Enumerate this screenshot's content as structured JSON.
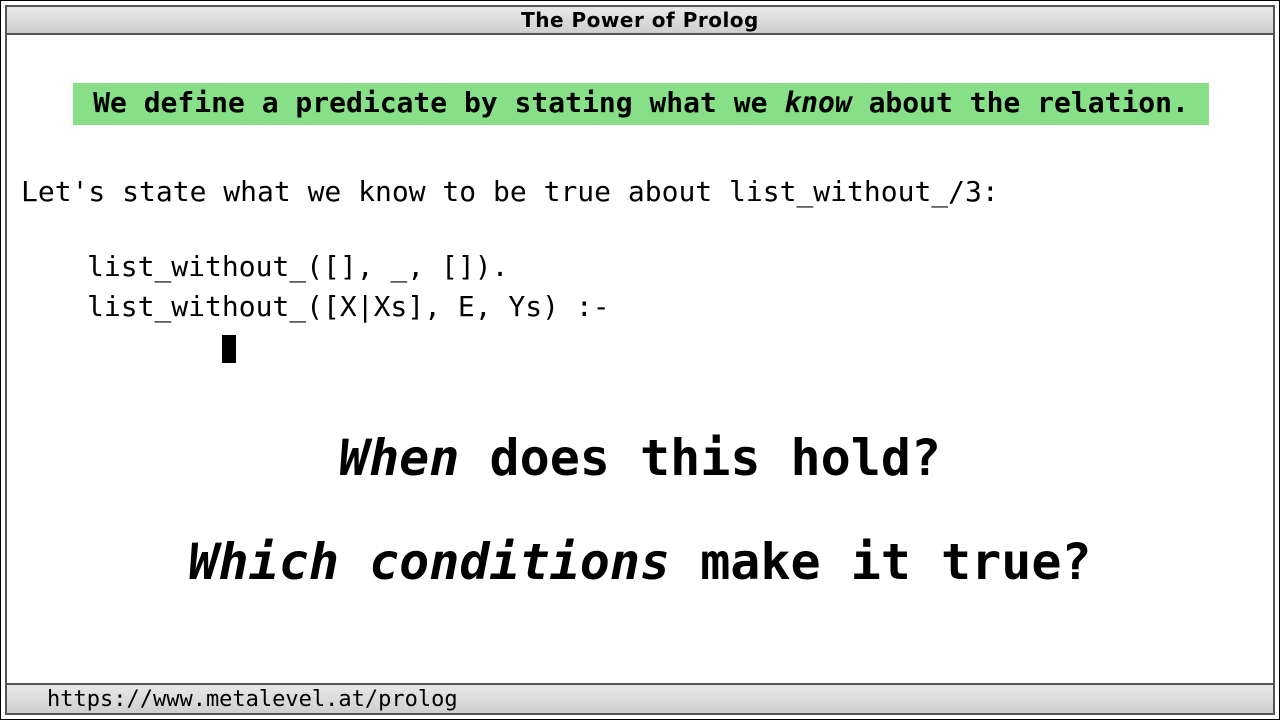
{
  "window": {
    "title": "The Power of Prolog"
  },
  "banner": {
    "pre": "We define a predicate by stating what we ",
    "em": "know",
    "post": " about the relation."
  },
  "intro": "Let's state what we know to be true about list_without_/3:",
  "code": {
    "line1": "list_without_([], _, []).",
    "line2": "list_without_([X|Xs], E, Ys) :-",
    "cursor_indent": "        "
  },
  "question1": {
    "em": "When",
    "rest": " does this hold?"
  },
  "question2": {
    "em": "Which conditions",
    "rest": " make it true?"
  },
  "statusbar": {
    "url": "https://www.metalevel.at/prolog"
  }
}
